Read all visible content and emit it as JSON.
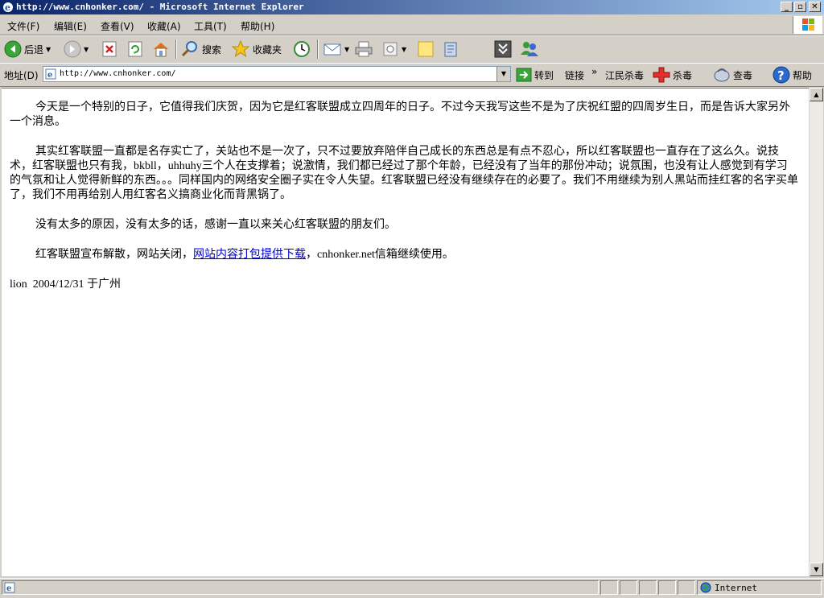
{
  "window": {
    "title": "http://www.cnhonker.com/ - Microsoft Internet Explorer"
  },
  "menu": [
    "文件(F)",
    "编辑(E)",
    "查看(V)",
    "收藏(A)",
    "工具(T)",
    "帮助(H)"
  ],
  "toolbar": {
    "back": "后退",
    "search": "搜索",
    "favorites": "收藏夹"
  },
  "address": {
    "label": "地址(D)",
    "url": "http://www.cnhonker.com/",
    "go": "转到",
    "links": "链接",
    "chevron": "»",
    "jiangmin": "江民杀毒",
    "kill": "杀毒",
    "scan": "查毒",
    "help": "帮助"
  },
  "content": {
    "p1": "今天是一个特别的日子，它值得我们庆贺，因为它是红客联盟成立四周年的日子。不过今天我写这些不是为了庆祝红盟的四周岁生日，而是告诉大家另外一个消息。",
    "p2": "其实红客联盟一直都是名存实亡了，关站也不是一次了，只不过要放弃陪伴自己成长的东西总是有点不忍心，所以红客联盟也一直存在了这么久。说技术，红客联盟也只有我，bkbll，uhhuhy三个人在支撑着；说激情，我们都已经过了那个年龄，已经没有了当年的那份冲动；说氛围，也没有让人感觉到有学习的气氛和让人觉得新鲜的东西。。。同样国内的网络安全圈子实在令人失望。红客联盟已经没有继续存在的必要了。我们不用继续为别人黑站而挂红客的名字买单了，我们不用再给别人用红客名义搞商业化而背黑锅了。",
    "p3": "没有太多的原因，没有太多的话，感谢一直以来关心红客联盟的朋友们。",
    "p4_pre": "红客联盟宣布解散，网站关闭，",
    "p4_link": "网站内容打包提供下载",
    "p4_post": "，cnhonker.net信箱继续使用。",
    "signature": "lion  2004/12/31 于广州"
  },
  "status": {
    "zone": "Internet"
  }
}
